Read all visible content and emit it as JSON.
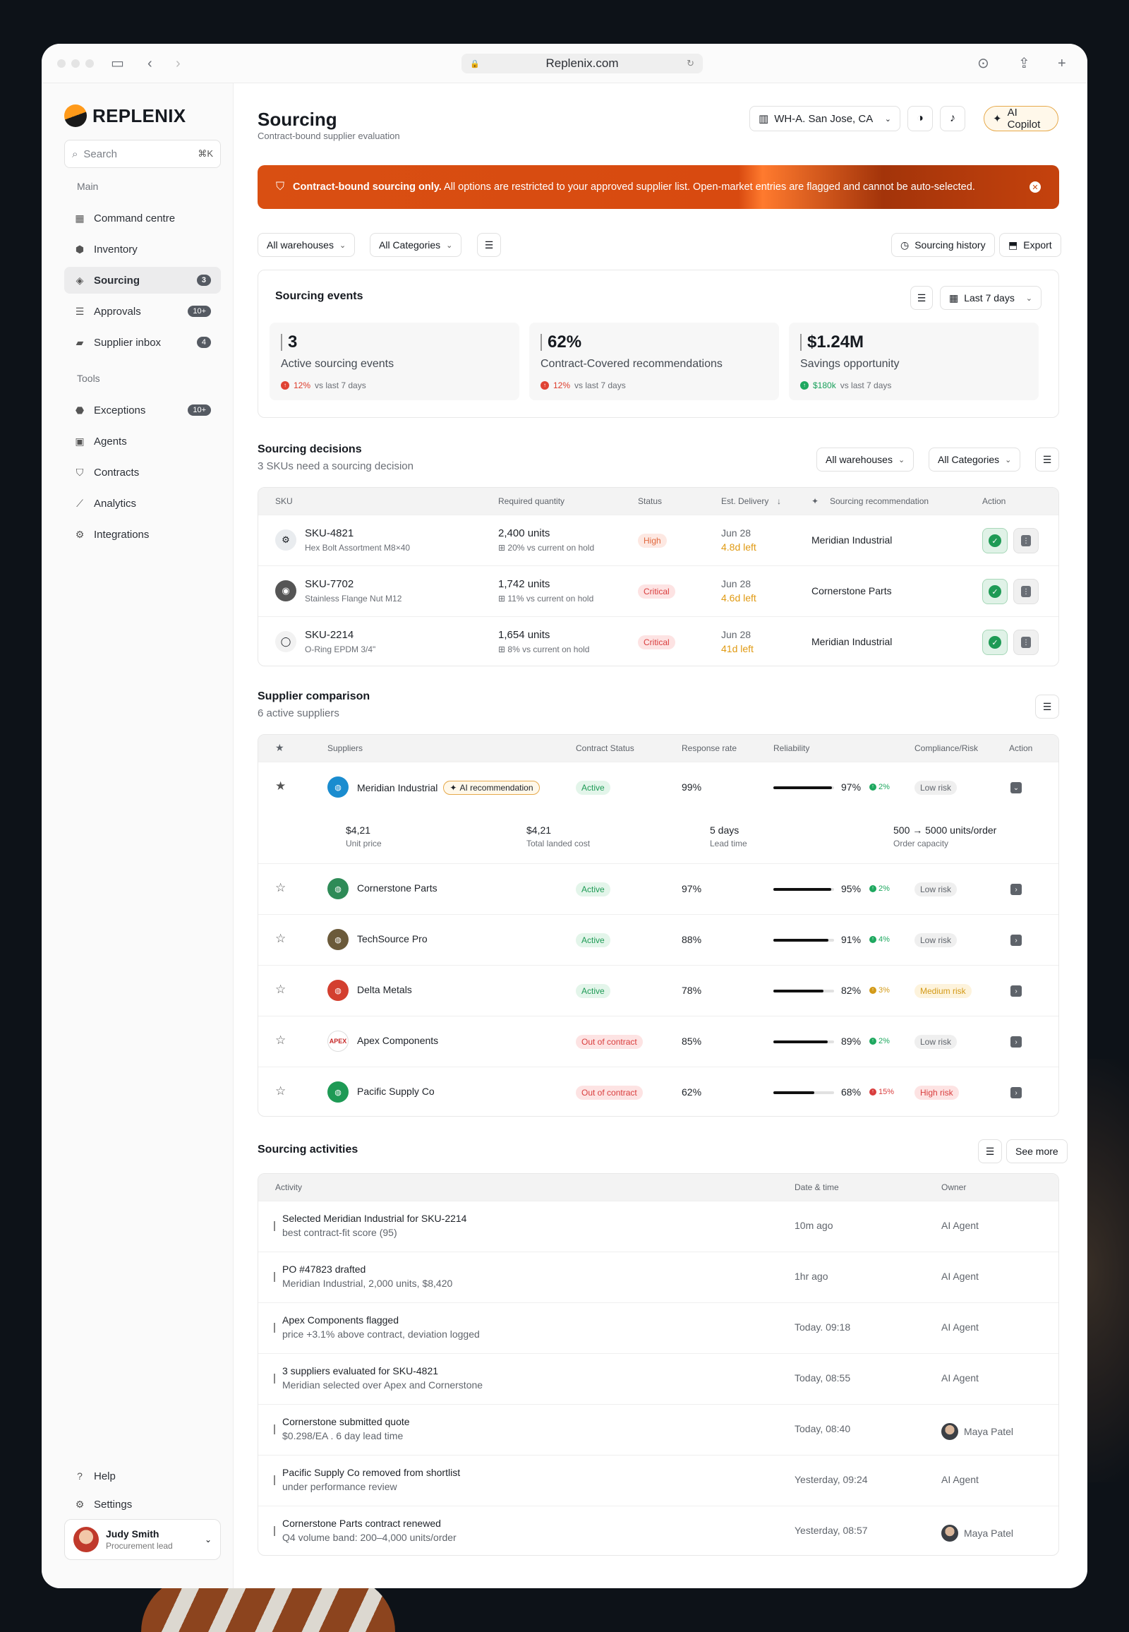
{
  "browser": {
    "url": "Replenix.com"
  },
  "brand": {
    "name": "REPLENIX",
    "accent": "#ff9a1a"
  },
  "search": {
    "placeholder": "Search",
    "shortcut": "⌘K"
  },
  "sidebar": {
    "main_label": "Main",
    "main_items": [
      {
        "label": "Command centre",
        "icon": "grid-icon"
      },
      {
        "label": "Inventory",
        "icon": "box-icon"
      },
      {
        "label": "Sourcing",
        "icon": "sourcing-icon",
        "badge": "3",
        "active": true
      },
      {
        "label": "Approvals",
        "icon": "list-check-icon",
        "badge": "10+"
      },
      {
        "label": "Supplier inbox",
        "icon": "chat-icon",
        "badge": "4"
      }
    ],
    "tools_label": "Tools",
    "tool_items": [
      {
        "label": "Exceptions",
        "icon": "alert-icon",
        "badge": "10+"
      },
      {
        "label": "Agents",
        "icon": "briefcase-icon"
      },
      {
        "label": "Contracts",
        "icon": "shield-icon"
      },
      {
        "label": "Analytics",
        "icon": "chart-icon"
      },
      {
        "label": "Integrations",
        "icon": "integration-icon"
      }
    ],
    "help": "Help",
    "settings": "Settings",
    "user": {
      "name": "Judy Smith",
      "role": "Procurement lead"
    }
  },
  "header": {
    "title": "Sourcing",
    "subtitle": "Contract-bound supplier evaluation",
    "warehouse": "WH-A. San Jose, CA",
    "copilot": "AI Copilot"
  },
  "banner": {
    "bold": "Contract-bound sourcing only.",
    "text": "All options are restricted to your approved supplier list. Open-market entries are flagged and cannot be auto-selected.",
    "color": "#d94f12"
  },
  "filters": {
    "warehouses": "All warehouses",
    "categories": "All Categories",
    "history": "Sourcing history",
    "export": "Export"
  },
  "events": {
    "title": "Sourcing events",
    "range": "Last 7 days",
    "stats": [
      {
        "value": "3",
        "label": "Active sourcing events",
        "delta": "12%",
        "suffix": "vs last 7 days",
        "dir": "up-bad"
      },
      {
        "value": "62%",
        "label": "Contract-Covered recommendations",
        "delta": "12%",
        "suffix": "vs last 7 days",
        "dir": "up-bad"
      },
      {
        "value": "$1.24M",
        "label": "Savings opportunity",
        "delta": "$180k",
        "suffix": "vs last 7 days",
        "dir": "up-good"
      }
    ]
  },
  "decisions": {
    "title": "Sourcing decisions",
    "subtitle": "3 SKUs need a sourcing decision",
    "warehouses": "All warehouses",
    "categories": "All Categories",
    "columns": [
      "SKU",
      "Required quantity",
      "Status",
      "Est. Delivery",
      "Sourcing recommendation",
      "Action"
    ],
    "rows": [
      {
        "sku": "SKU-4821",
        "desc": "Hex Bolt Assortment M8×40",
        "qty": "2,400 units",
        "hold": "20%",
        "hold_suffix": "vs current on hold",
        "status": "High",
        "date": "Jun 28",
        "left": "4.8d left",
        "rec": "Meridian Industrial"
      },
      {
        "sku": "SKU-7702",
        "desc": "Stainless Flange Nut M12",
        "qty": "1,742 units",
        "hold": "11%",
        "hold_suffix": "vs current on hold",
        "status": "Critical",
        "date": "Jun 28",
        "left": "4.6d left",
        "rec": "Cornerstone Parts"
      },
      {
        "sku": "SKU-2214",
        "desc": "O-Ring EPDM 3/4\"",
        "qty": "1,654 units",
        "hold": "8%",
        "hold_suffix": "vs current on hold",
        "status": "Critical",
        "date": "Jun 28",
        "left": "41d left",
        "rec": "Meridian Industrial"
      }
    ]
  },
  "suppliers": {
    "title": "Supplier comparison",
    "subtitle": "6 active suppliers",
    "columns": [
      "Suppliers",
      "Contract Status",
      "Response rate",
      "Reliability",
      "Compliance/Risk",
      "Action"
    ],
    "ai_tag": "AI recommendation",
    "expanded": {
      "unit_price": "$4,21",
      "unit_price_label": "Unit price",
      "landed": "$4,21",
      "landed_label": "Total landed cost",
      "lead": "5 days",
      "lead_label": "Lead time",
      "capacity": "500 → 5000 units/order",
      "capacity_label": "Order capacity"
    },
    "rows": [
      {
        "name": "Meridian Industrial",
        "status": "Active",
        "response": "99%",
        "reliability": 97,
        "rel_label": "97%",
        "delta": "2%",
        "delta_dir": "good",
        "risk": "Low risk",
        "risk_level": "low",
        "logo_color": "#1a8ccf",
        "starred": true
      },
      {
        "name": "Cornerstone Parts",
        "status": "Active",
        "response": "97%",
        "reliability": 95,
        "rel_label": "95%",
        "delta": "2%",
        "delta_dir": "good",
        "risk": "Low risk",
        "risk_level": "low",
        "logo_color": "#2e8b57"
      },
      {
        "name": "TechSource Pro",
        "status": "Active",
        "response": "88%",
        "reliability": 91,
        "rel_label": "91%",
        "delta": "4%",
        "delta_dir": "good",
        "risk": "Low risk",
        "risk_level": "low",
        "logo_color": "#6b5a3a"
      },
      {
        "name": "Delta Metals",
        "status": "Active",
        "response": "78%",
        "reliability": 82,
        "rel_label": "82%",
        "delta": "3%",
        "delta_dir": "warn",
        "risk": "Medium risk",
        "risk_level": "med",
        "logo_color": "#d33f2f"
      },
      {
        "name": "Apex Components",
        "status": "Out of contract",
        "response": "85%",
        "reliability": 89,
        "rel_label": "89%",
        "delta": "2%",
        "delta_dir": "good",
        "risk": "Low risk",
        "risk_level": "low",
        "logo_color": "#ffffff",
        "logo_text": "APEX"
      },
      {
        "name": "Pacific Supply Co",
        "status": "Out of contract",
        "response": "62%",
        "reliability": 68,
        "rel_label": "68%",
        "delta": "15%",
        "delta_dir": "bad",
        "risk": "High risk",
        "risk_level": "high",
        "logo_color": "#1e9a55"
      }
    ]
  },
  "activities": {
    "title": "Sourcing activities",
    "see_more": "See more",
    "columns": [
      "Activity",
      "Date & time",
      "Owner"
    ],
    "rows": [
      {
        "title": "Selected Meridian Industrial for SKU-2214",
        "sub": "best contract-fit score (95)",
        "date": "10m ago",
        "owner": "AI Agent"
      },
      {
        "title": "PO #47823 drafted",
        "sub": "Meridian Industrial, 2,000 units, $8,420",
        "date": "1hr ago",
        "owner": "AI Agent"
      },
      {
        "title": "Apex Components flagged",
        "sub": "price +3.1% above contract, deviation logged",
        "date": "Today. 09:18",
        "owner": "AI Agent"
      },
      {
        "title": "3 suppliers evaluated for SKU-4821",
        "sub": "Meridian selected over Apex and Cornerstone",
        "date": "Today, 08:55",
        "owner": "AI Agent"
      },
      {
        "title": "Cornerstone submitted quote",
        "sub": "$0.298/EA . 6 day lead time",
        "date": "Today, 08:40",
        "owner": "Maya Patel",
        "avatar": true
      },
      {
        "title": "Pacific Supply Co removed from shortlist",
        "sub": "under performance review",
        "date": "Yesterday, 09:24",
        "owner": "AI Agent"
      },
      {
        "title": "Cornerstone Parts contract renewed",
        "sub": "Q4 volume band: 200–4,000 units/order",
        "date": "Yesterday, 08:57",
        "owner": "Maya Patel",
        "avatar": true
      }
    ]
  }
}
